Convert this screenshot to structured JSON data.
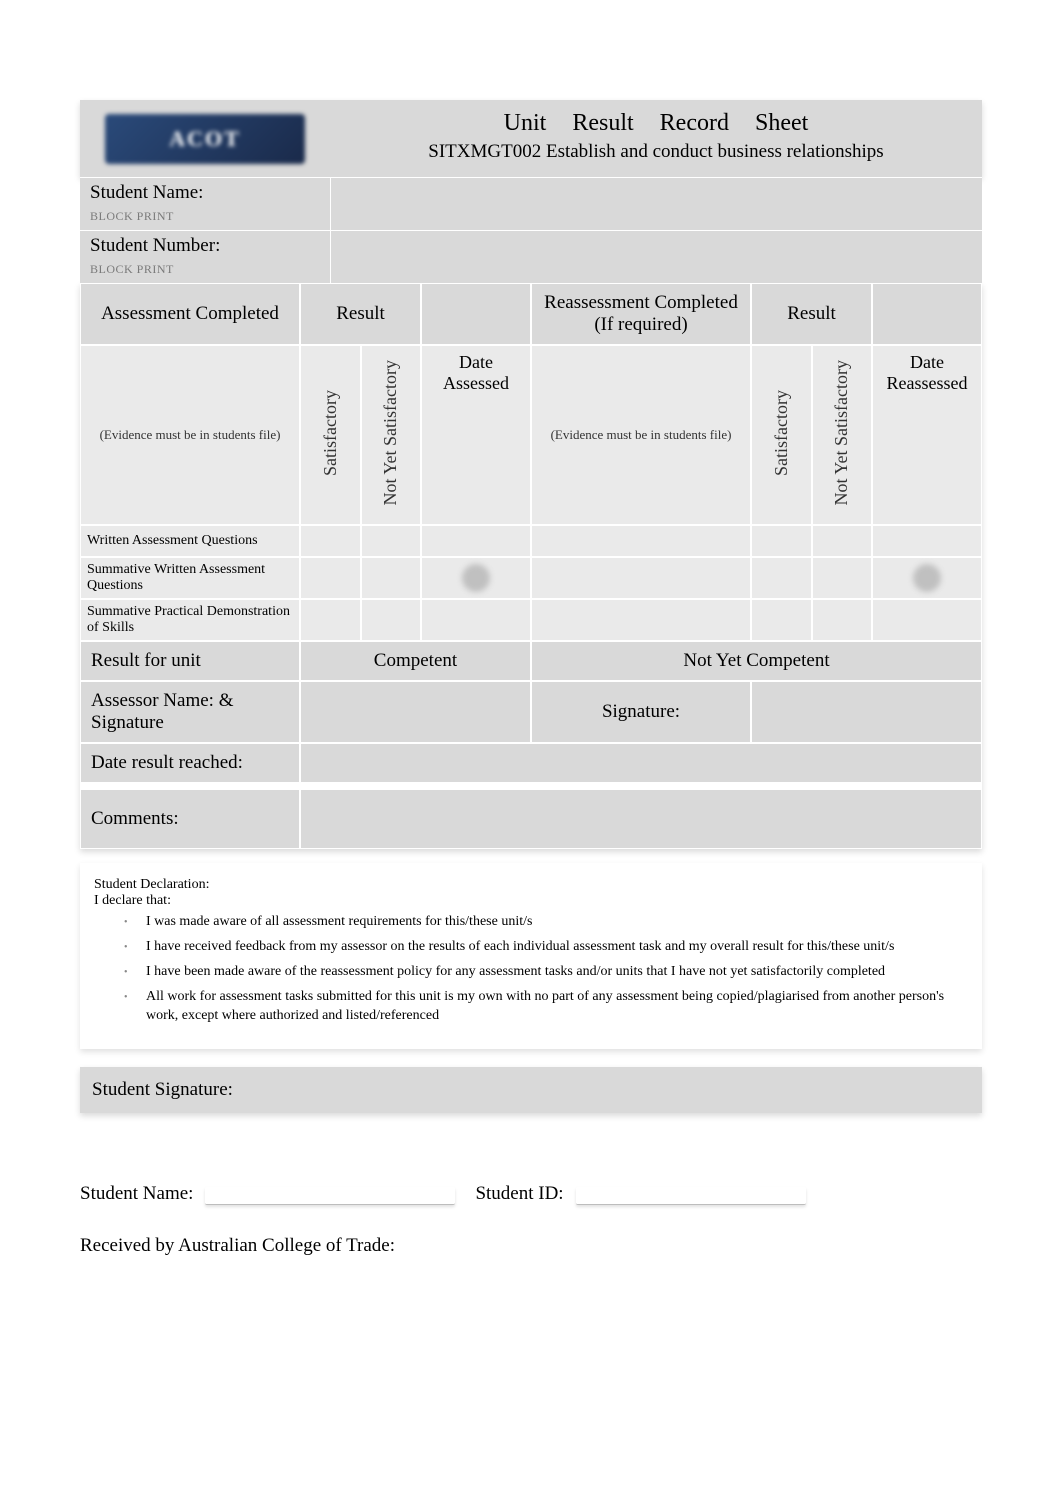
{
  "header": {
    "logo_text": "ACOT",
    "title": "Unit Result Record Sheet",
    "subtitle": "SITXMGT002 Establish and conduct business relationships"
  },
  "fields": {
    "student_name_label": "Student Name:",
    "student_number_label": "Student Number:",
    "block_print_hint": "BLOCK Print"
  },
  "table": {
    "assessment_completed_hdr": "Assessment Completed",
    "result_hdr": "Result",
    "reassessment_completed_hdr": "Reassessment Completed (If required)",
    "evidence_note": "(Evidence must be in students file)",
    "satisfactory_hdr": "Satisfactory",
    "not_yet_satisfactory_hdr": "Not Yet Satisfactory",
    "date_assessed_hdr": "Date Assessed",
    "date_reassessed_hdr": "Date Reassessed",
    "rows": [
      {
        "name": "Written Assessment Questions"
      },
      {
        "name": "Summative Written Assessment Questions"
      },
      {
        "name": "Summative Practical Demonstration of Skills"
      }
    ],
    "result_for_unit_label": "Result for unit",
    "competent_label": "Competent",
    "not_yet_competent_label": "Not Yet Competent",
    "assessor_name_label": "Assessor Name: & Signature",
    "signature_label": "Signature:",
    "date_result_reached_label": "Date result reached:",
    "comments_label": "Comments:"
  },
  "declaration": {
    "heading": "Student Declaration:",
    "intro": "I declare that:",
    "items": [
      "I was made aware of all assessment requirements for this/these unit/s",
      "I have received feedback from my assessor on the results of each individual assessment task and my overall result for this/these unit/s",
      "I have been made aware of the reassessment policy for any assessment tasks and/or units that I have not yet satisfactorily completed",
      "All work for assessment tasks submitted for this unit is my own with no part of any assessment being copied/plagiarised from another person's work, except where authorized and listed/referenced"
    ]
  },
  "student_signature_label": "Student Signature:",
  "footer": {
    "student_name_label": "Student Name:",
    "student_id_label": "Student ID:",
    "received_by_label": "Received by Australian College of Trade:"
  }
}
